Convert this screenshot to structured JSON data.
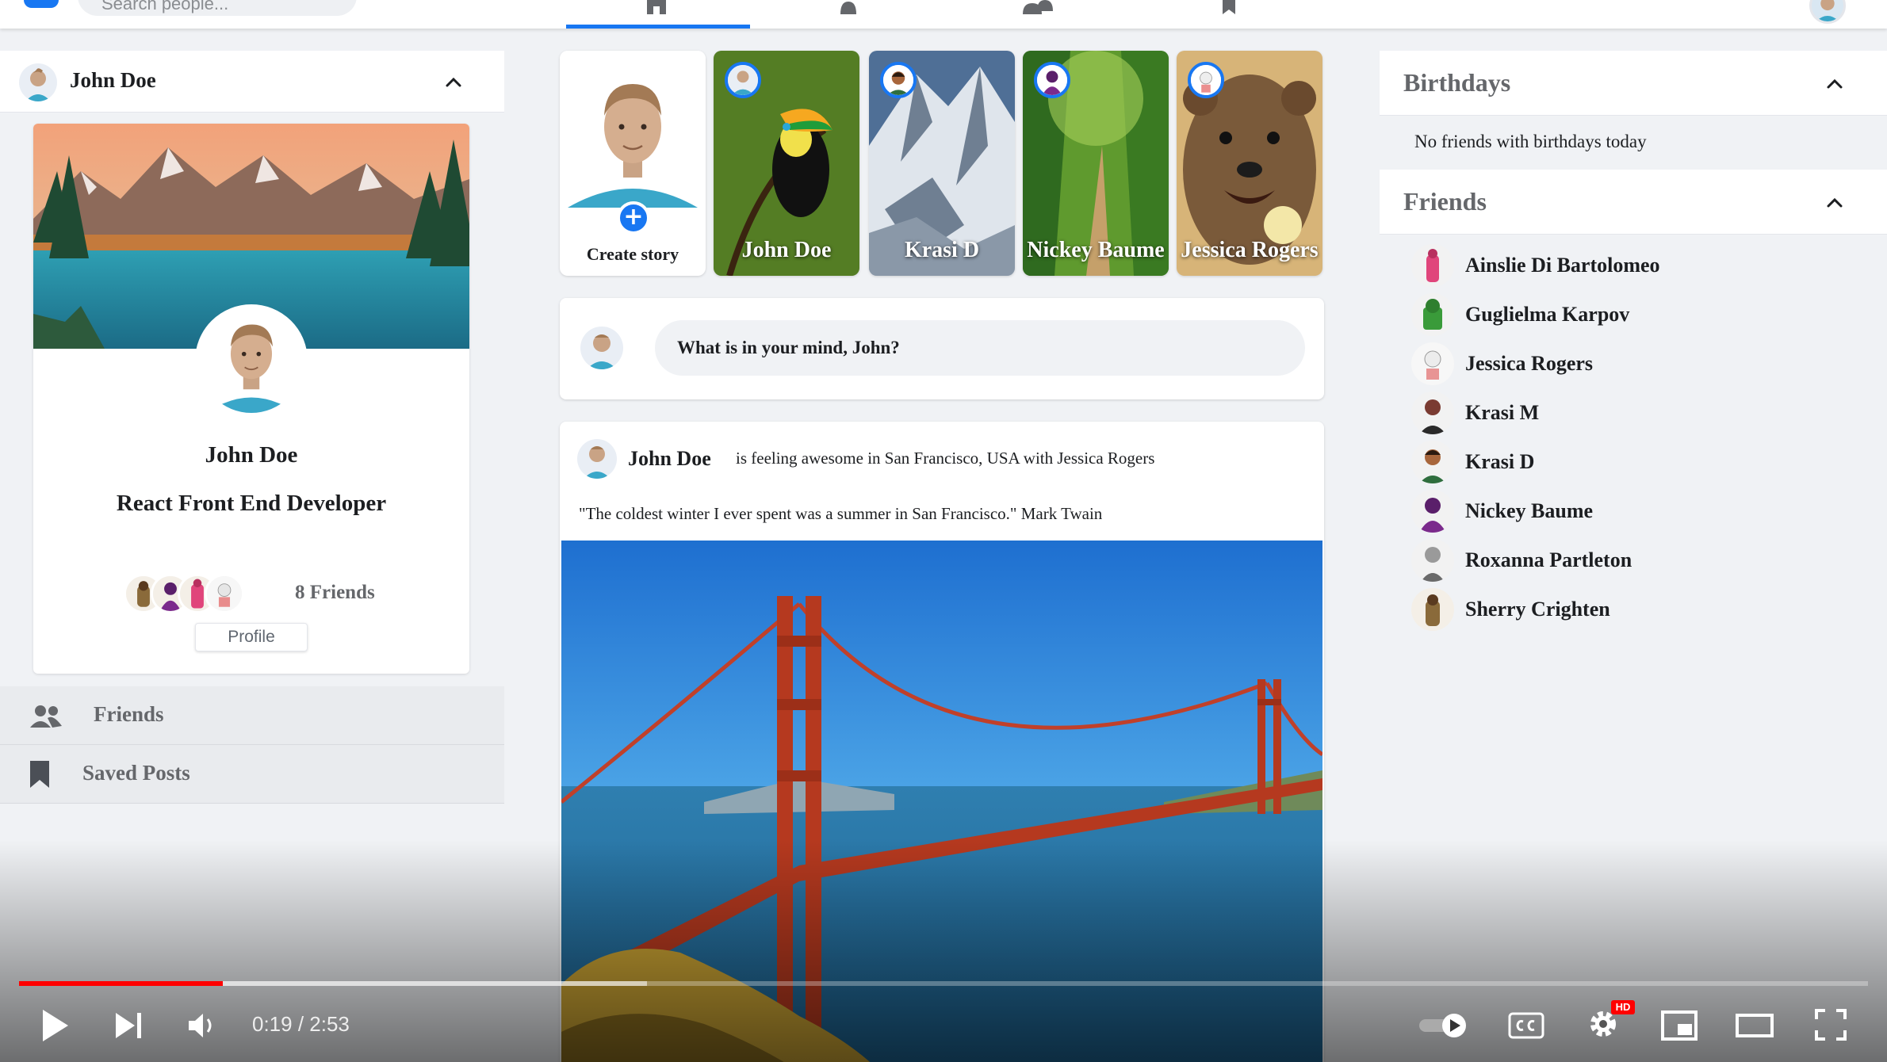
{
  "topbar": {
    "search_placeholder": "Search people..."
  },
  "left": {
    "header_name": "John Doe",
    "card": {
      "name": "John Doe",
      "role": "React Front End Developer",
      "friend_count": "8 Friends",
      "profile_button": "Profile"
    },
    "links": [
      {
        "label": "Friends",
        "icon": "friends-icon"
      },
      {
        "label": "Saved Posts",
        "icon": "bookmark-icon"
      }
    ]
  },
  "stories": {
    "create_label": "Create story",
    "items": [
      {
        "name": "John Doe"
      },
      {
        "name": "Krasi D"
      },
      {
        "name": "Nickey Baume"
      },
      {
        "name": "Jessica Rogers"
      }
    ]
  },
  "composer": {
    "placeholder": "What is in your mind, John?"
  },
  "post": {
    "author": "John Doe",
    "activity": "is feeling awesome in San Francisco, USA with Jessica Rogers",
    "text": "\"The coldest winter I ever spent was a summer in San Francisco.\" Mark Twain"
  },
  "right": {
    "birthdays_title": "Birthdays",
    "no_birthdays": "No friends with birthdays today",
    "friends_title": "Friends",
    "friends": [
      {
        "name": "Ainslie Di Bartolomeo",
        "color": "#e0457b"
      },
      {
        "name": "Guglielma Karpov",
        "color": "#3a9b3a"
      },
      {
        "name": "Jessica Rogers",
        "color": "#d7d7d7"
      },
      {
        "name": "Krasi M",
        "color": "#7a3b32"
      },
      {
        "name": "Krasi D",
        "color": "#2f6e3e"
      },
      {
        "name": "Nickey Baume",
        "color": "#7b2a8c"
      },
      {
        "name": "Roxanna Partleton",
        "color": "#8a8a8a"
      },
      {
        "name": "Sherry Crighten",
        "color": "#8a6a3a"
      }
    ]
  },
  "player": {
    "time": "0:19 / 2:53",
    "progress": 0.11,
    "hd_label": "HD",
    "accent": "#ff0000"
  }
}
